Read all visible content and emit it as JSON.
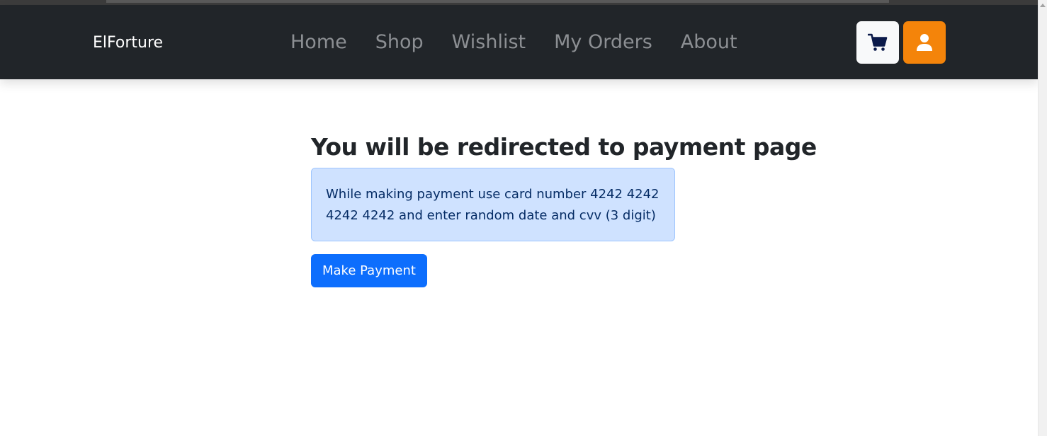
{
  "navbar": {
    "brand": "ElForture",
    "links": [
      "Home",
      "Shop",
      "Wishlist",
      "My Orders",
      "About"
    ],
    "cart_icon": "cart-icon",
    "user_icon": "user-icon",
    "colors": {
      "background": "#212529",
      "link": "#8c8f93",
      "cart_button": "#f8f9fa",
      "user_button": "#f4840a"
    }
  },
  "main": {
    "heading": "You will be redirected to payment page",
    "alert_text": "While making payment use card number 4242 4242 4242 4242 and enter random date and cvv (3 digit)",
    "pay_button_label": "Make Payment",
    "colors": {
      "alert_bg": "#cfe2ff",
      "alert_border": "#9ec5fe",
      "alert_text": "#052c65",
      "button": "#0d6efd"
    }
  }
}
